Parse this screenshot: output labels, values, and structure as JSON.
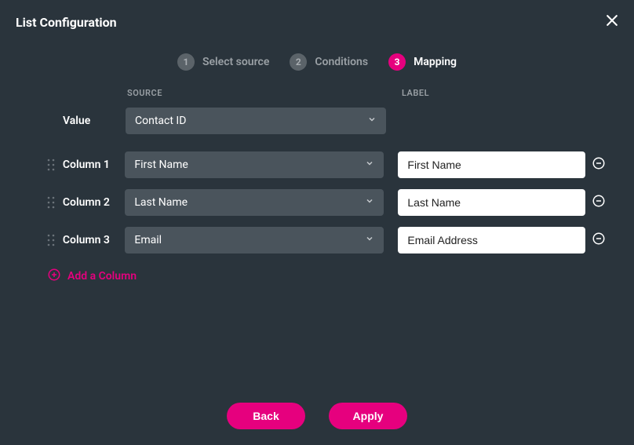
{
  "header": {
    "title": "List Configuration"
  },
  "stepper": {
    "steps": [
      {
        "num": "1",
        "label": "Select source",
        "active": false
      },
      {
        "num": "2",
        "label": "Conditions",
        "active": false
      },
      {
        "num": "3",
        "label": "Mapping",
        "active": true
      }
    ]
  },
  "columns": {
    "source_header": "SOURCE",
    "label_header": "LABEL"
  },
  "value_row": {
    "label": "Value",
    "source": "Contact ID"
  },
  "rows": [
    {
      "label": "Column 1",
      "source": "First Name",
      "text": "First Name"
    },
    {
      "label": "Column 2",
      "source": "Last Name",
      "text": "Last Name"
    },
    {
      "label": "Column 3",
      "source": "Email",
      "text": "Email Address"
    }
  ],
  "add_column_label": "Add a Column",
  "footer": {
    "back": "Back",
    "apply": "Apply"
  }
}
